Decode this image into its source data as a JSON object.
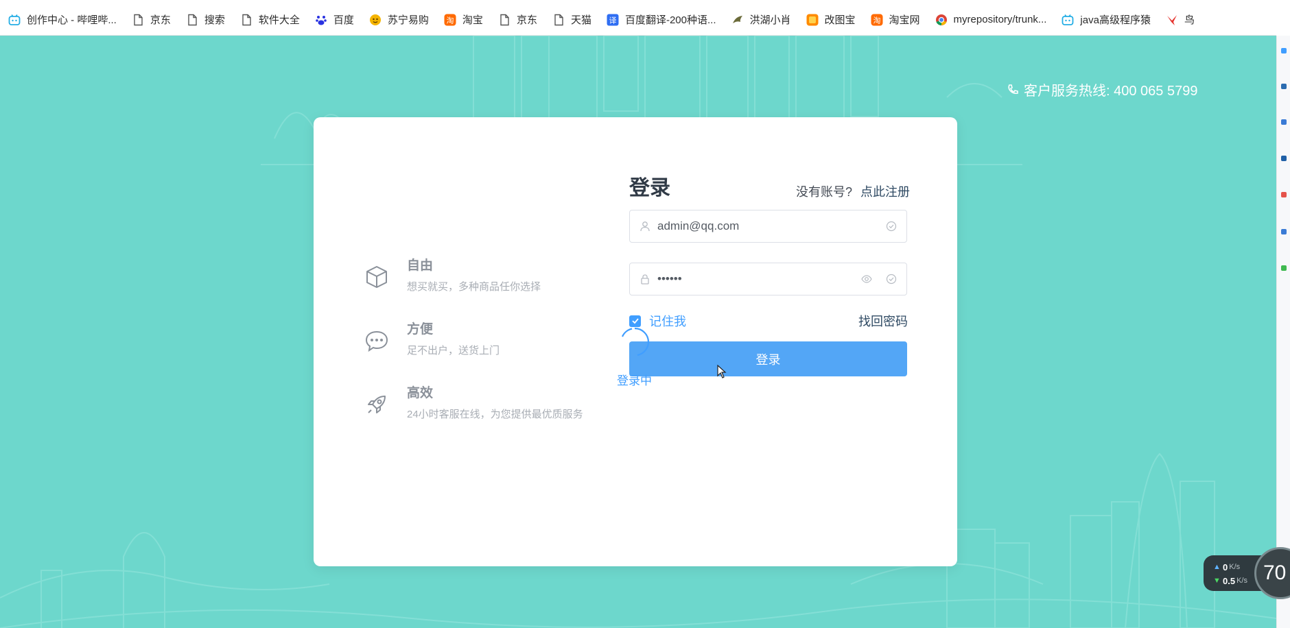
{
  "bookmarks": [
    {
      "label": "创作中心 - 哔哩哔...",
      "icon": "bilibili-icon"
    },
    {
      "label": "京东",
      "icon": "page-icon"
    },
    {
      "label": "搜索",
      "icon": "page-icon"
    },
    {
      "label": "软件大全",
      "icon": "page-icon"
    },
    {
      "label": "百度",
      "icon": "baidu-icon"
    },
    {
      "label": "苏宁易购",
      "icon": "suning-icon"
    },
    {
      "label": "淘宝",
      "icon": "taobao-icon"
    },
    {
      "label": "京东",
      "icon": "page-icon"
    },
    {
      "label": "天猫",
      "icon": "page-icon"
    },
    {
      "label": "百度翻译-200种语...",
      "icon": "translate-icon"
    },
    {
      "label": "洪湖小肖",
      "icon": "bird-icon"
    },
    {
      "label": "改图宝",
      "icon": "gaitubao-icon"
    },
    {
      "label": "淘宝网",
      "icon": "taobao-icon"
    },
    {
      "label": "myrepository/trunk...",
      "icon": "chrome-icon"
    },
    {
      "label": "java高级程序猿",
      "icon": "bilibili-icon"
    },
    {
      "label": "鸟",
      "icon": "bird-red-icon"
    }
  ],
  "hotline": {
    "text": "客户服务热线: 400 065 5799"
  },
  "features": [
    {
      "title": "自由",
      "desc": "想买就买，多种商品任你选择",
      "icon": "cube-icon"
    },
    {
      "title": "方便",
      "desc": "足不出户，送货上门",
      "icon": "chat-icon"
    },
    {
      "title": "高效",
      "desc": "24小时客服在线，为您提供最优质服务",
      "icon": "rocket-icon"
    }
  ],
  "login": {
    "title": "登录",
    "no_account": "没有账号?",
    "register_link": "点此注册",
    "username_value": "admin@qq.com",
    "password_value": "••••••",
    "remember_label": "记住我",
    "remember_checked": true,
    "forgot_label": "找回密码",
    "button_label": "登录",
    "loading_text": "登录中"
  },
  "netspeed": {
    "up": "0",
    "up_unit": "K/s",
    "down": "0.5",
    "down_unit": "K/s",
    "gauge": "70"
  },
  "colors": {
    "background": "#6dd7cc",
    "primary": "#409eff",
    "button": "#53a6f6",
    "title": "#303a46"
  }
}
